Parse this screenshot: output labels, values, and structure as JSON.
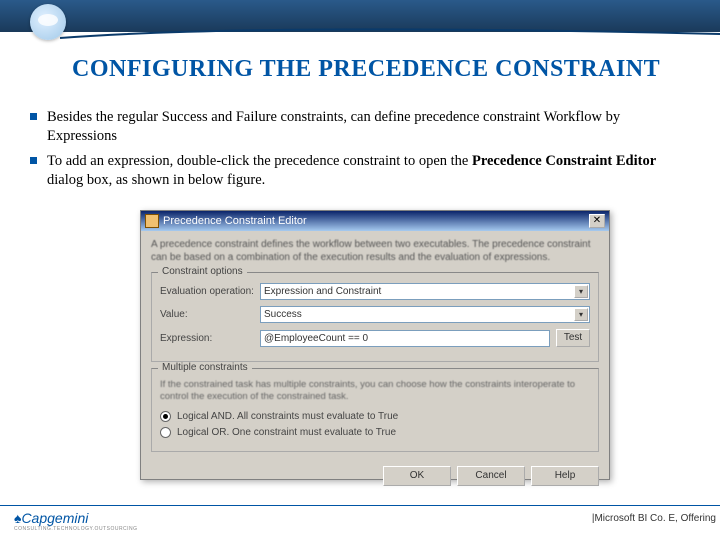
{
  "slide": {
    "title": "CONFIGURING THE PRECEDENCE CONSTRAINT",
    "bullets": [
      "Besides the regular Success and Failure constraints, can define precedence constraint Workflow by Expressions",
      "To add an expression, double-click the precedence constraint to open the <b>Precedence Constraint Editor</b> dialog box, as shown in below figure."
    ]
  },
  "dialog": {
    "title": "Precedence Constraint Editor",
    "description": "A precedence constraint defines the workflow between two executables. The precedence constraint can be based on a combination of the execution results and the evaluation of expressions.",
    "constraint_options": {
      "legend": "Constraint options",
      "eval_label": "Evaluation operation:",
      "eval_value": "Expression and Constraint",
      "value_label": "Value:",
      "value_value": "Success",
      "expr_label": "Expression:",
      "expr_value": "@EmployeeCount == 0",
      "test_label": "Test"
    },
    "multiple_constraints": {
      "legend": "Multiple constraints",
      "desc": "If the constrained task has multiple constraints, you can choose how the constraints interoperate to control the execution of the constrained task.",
      "radio_and": "Logical AND. All constraints must evaluate to True",
      "radio_or": "Logical OR. One constraint must evaluate to True",
      "selected": "and"
    },
    "buttons": {
      "ok": "OK",
      "cancel": "Cancel",
      "help": "Help"
    }
  },
  "footer": {
    "brand": "Capgemini",
    "brand_sub": "CONSULTING.TECHNOLOGY.OUTSOURCING",
    "right": "|Microsoft BI Co. E, Offering"
  }
}
